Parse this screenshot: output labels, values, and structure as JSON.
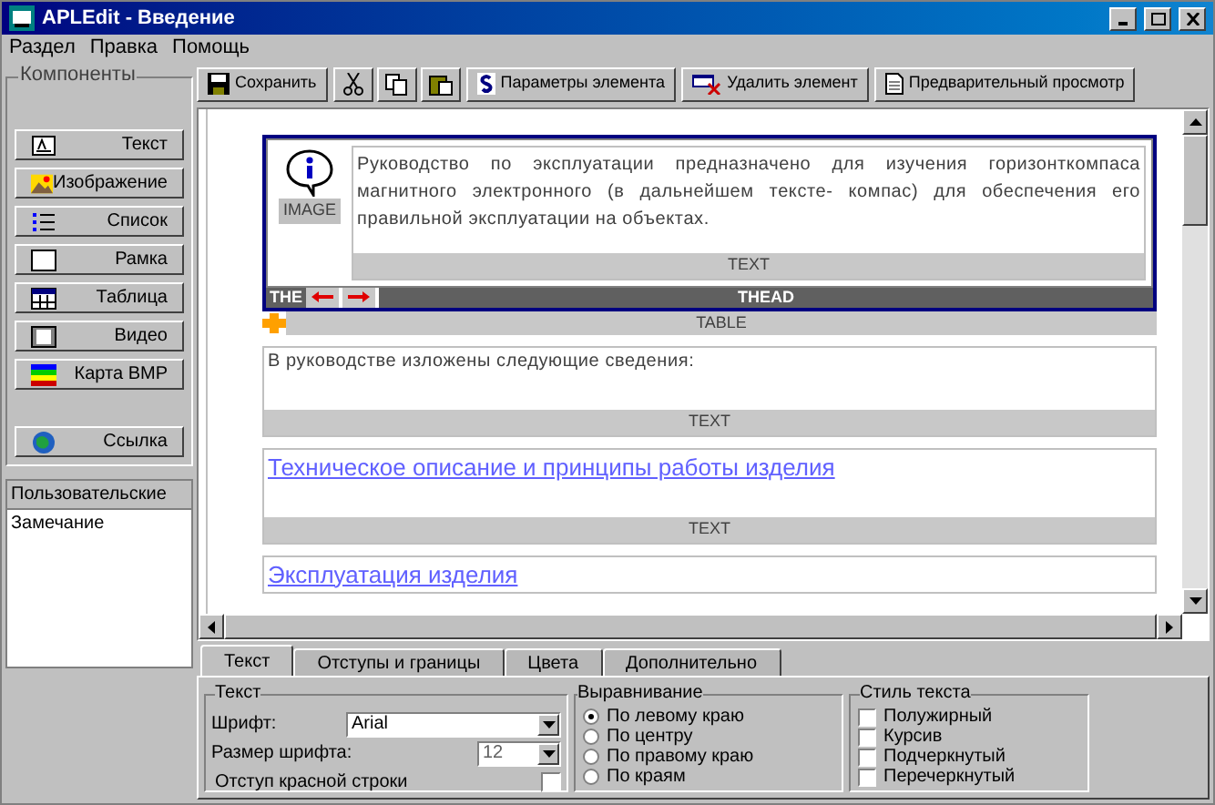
{
  "window": {
    "title": "APLEdit - Введение"
  },
  "menu": [
    "Раздел",
    "Правка",
    "Помощь"
  ],
  "sidebar": {
    "title": "Компоненты",
    "components": [
      {
        "label": "Текст"
      },
      {
        "label": "Изображение"
      },
      {
        "label": "Список"
      },
      {
        "label": "Рамка"
      },
      {
        "label": "Таблица"
      },
      {
        "label": "Видео"
      },
      {
        "label": "Карта BMP"
      }
    ],
    "link": {
      "label": "Ссылка"
    },
    "user_list": {
      "header": "Пользовательские",
      "items": [
        "Замечание"
      ]
    }
  },
  "toolbar": {
    "buttons": [
      "Сохранить",
      "Параметры элемента",
      "Удалить элемент",
      "Предварительный просмотр"
    ]
  },
  "document": {
    "table": {
      "image_label": "IMAGE",
      "text": "Руководство по эксплуатации предназначено для изучения горизонткомпаса магнитного электронного (в дальнейшем тексте- компас) для обеспечения его правильной эксплуатации на объектах.",
      "text_tag": "TEXT",
      "head_short": "THE",
      "head_tag": "THEAD",
      "table_tag": "TABLE"
    },
    "blocks": [
      {
        "kind": "text",
        "text": "В руководстве изложены следующие сведения:",
        "tag": "TEXT"
      },
      {
        "kind": "link",
        "text": "Техническое описание и принципы работы изделия",
        "tag": "TEXT"
      },
      {
        "kind": "link",
        "text": "Эксплуатация изделия"
      }
    ]
  },
  "tabs": [
    {
      "label": "Текст",
      "selected": true
    },
    {
      "label": "Отступы и границы",
      "selected": false
    },
    {
      "label": "Цвета",
      "selected": false
    },
    {
      "label": "Дополнительно",
      "selected": false
    }
  ],
  "text_group": {
    "title": "Текст",
    "font_label": "Шрифт:",
    "font_value": "Arial",
    "size_label": "Размер шрифта:",
    "size_value": "12",
    "indent_label": "Отступ красной строки",
    "indent_checked": false
  },
  "align_group": {
    "title": "Выравнивание",
    "options": [
      {
        "label": "По левому краю",
        "selected": true
      },
      {
        "label": "По центру",
        "selected": false
      },
      {
        "label": "По правому краю",
        "selected": false
      },
      {
        "label": "По краям",
        "selected": false
      }
    ]
  },
  "style_group": {
    "title": "Стиль текста",
    "options": [
      {
        "label": "Полужирный",
        "checked": false
      },
      {
        "label": "Курсив",
        "checked": false
      },
      {
        "label": "Подчеркнутый",
        "checked": false
      },
      {
        "label": "Перечеркнутый",
        "checked": false
      }
    ]
  }
}
